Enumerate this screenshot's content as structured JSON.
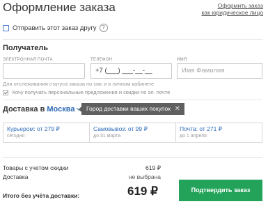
{
  "header": {
    "title": "Оформление заказа",
    "corp_link_line1": "Оформить заказ",
    "corp_link_line2": "как юридическое лицо"
  },
  "gift": {
    "label": "Отправить этот заказ другу",
    "help": "?"
  },
  "recipient": {
    "title": "Получатель",
    "email_label": "электронная почта",
    "email_value": "",
    "phone_label": "телефон",
    "phone_value": "+7 (___) ___-__-__",
    "name_label": "имя",
    "name_placeholder": "Имя Фамилия",
    "note": "Для отслеживания статуса заказа по смс и в личном кабинете",
    "promo_label": "Хочу получать персональные предложения и скидки по эл. почте",
    "promo_checked": true
  },
  "delivery": {
    "title": "Доставка в",
    "city": "Москва",
    "tooltip": "Город доставки ваших покупок",
    "tooltip_close": "✕",
    "options": [
      {
        "title": "Курьером: от 279 ₽",
        "sub": "сегодня"
      },
      {
        "title": "Самовывоз: от 99 ₽",
        "sub": "до 31 марта"
      },
      {
        "title": "Почта: от 271 ₽",
        "sub": "до 1 апреля"
      }
    ]
  },
  "summary": {
    "goods_label": "Товары с учетом скидки",
    "goods_value": "619 ₽",
    "delivery_label": "Доставка",
    "delivery_value": "не выбрана",
    "total_label": "Итого без учёта доставки:",
    "total_value": "619 ₽",
    "confirm_label": "Подтвердить заказ"
  },
  "colors": {
    "accent": "#2e6bb8",
    "confirm": "#23a35a",
    "tooltip_bg": "#5f5f5f"
  }
}
